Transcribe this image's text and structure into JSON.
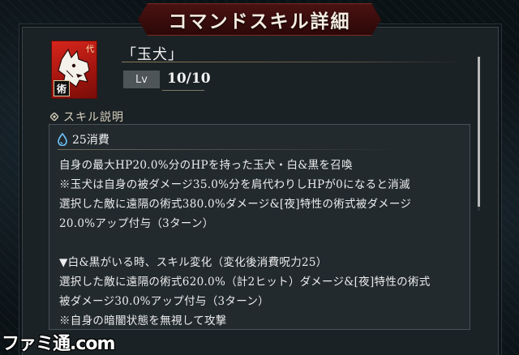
{
  "header": {
    "title": "コマンドスキル詳細"
  },
  "skill": {
    "icon_name": "white-dog-jutsu-icon",
    "icon_mark": "術",
    "icon_corner": "代",
    "name": "「玉犬」",
    "lv_label": "Lv",
    "level": "10",
    "separator": "/",
    "max_level": "10"
  },
  "description": {
    "heading": "スキル説明",
    "cost": "25消費",
    "lines": [
      "自身の最大HP20.0%分のHPを持った玉犬・白&黒を召喚",
      "※玉犬は自身の被ダメージ35.0%分を肩代わりしHPが0になると消滅",
      "選択した敵に遠隔の術式380.0%ダメージ&[夜]特性の術式被ダメージ",
      "20.0%アップ付与（3ターン）",
      "",
      "▼白&黒がいる時、スキル変化（変化後消費呪力25）",
      "選択した敵に遠隔の術式620.0%（計2ヒット）ダメージ&[夜]特性の術式",
      "被ダメージ30.0%アップ付与（3ターン）",
      "※自身の暗闇状態を無視して攻撃"
    ]
  },
  "watermark": "ファミ通.com",
  "colors": {
    "banner": "#4a1212",
    "icon_bg": "#d7261c",
    "panel": "#1b2226"
  }
}
